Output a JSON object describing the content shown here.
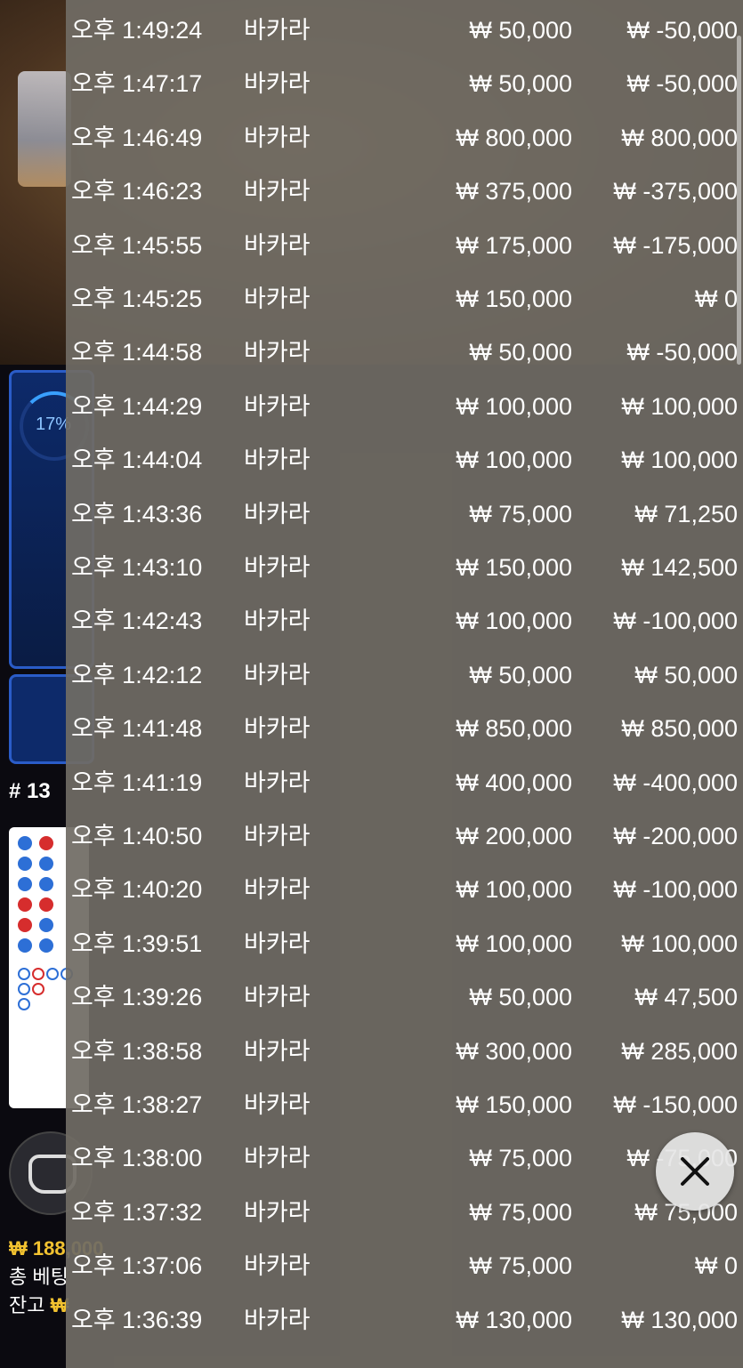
{
  "background": {
    "progress_label": "17%",
    "round_label": "# 13",
    "bet_total": "₩ 188,000",
    "total_bet_label": "총 베팅",
    "balance_label": "잔고",
    "balance_symbol": "₩"
  },
  "history": {
    "rows": [
      {
        "time": "오후 1:49:24",
        "game": "바카라",
        "bet": "₩ 50,000",
        "win": "₩ -50,000"
      },
      {
        "time": "오후 1:47:17",
        "game": "바카라",
        "bet": "₩ 50,000",
        "win": "₩ -50,000"
      },
      {
        "time": "오후 1:46:49",
        "game": "바카라",
        "bet": "₩ 800,000",
        "win": "₩ 800,000"
      },
      {
        "time": "오후 1:46:23",
        "game": "바카라",
        "bet": "₩ 375,000",
        "win": "₩ -375,000"
      },
      {
        "time": "오후 1:45:55",
        "game": "바카라",
        "bet": "₩ 175,000",
        "win": "₩ -175,000"
      },
      {
        "time": "오후 1:45:25",
        "game": "바카라",
        "bet": "₩ 150,000",
        "win": "₩ 0"
      },
      {
        "time": "오후 1:44:58",
        "game": "바카라",
        "bet": "₩ 50,000",
        "win": "₩ -50,000"
      },
      {
        "time": "오후 1:44:29",
        "game": "바카라",
        "bet": "₩ 100,000",
        "win": "₩ 100,000"
      },
      {
        "time": "오후 1:44:04",
        "game": "바카라",
        "bet": "₩ 100,000",
        "win": "₩ 100,000"
      },
      {
        "time": "오후 1:43:36",
        "game": "바카라",
        "bet": "₩ 75,000",
        "win": "₩ 71,250"
      },
      {
        "time": "오후 1:43:10",
        "game": "바카라",
        "bet": "₩ 150,000",
        "win": "₩ 142,500"
      },
      {
        "time": "오후 1:42:43",
        "game": "바카라",
        "bet": "₩ 100,000",
        "win": "₩ -100,000"
      },
      {
        "time": "오후 1:42:12",
        "game": "바카라",
        "bet": "₩ 50,000",
        "win": "₩ 50,000"
      },
      {
        "time": "오후 1:41:48",
        "game": "바카라",
        "bet": "₩ 850,000",
        "win": "₩ 850,000"
      },
      {
        "time": "오후 1:41:19",
        "game": "바카라",
        "bet": "₩ 400,000",
        "win": "₩ -400,000"
      },
      {
        "time": "오후 1:40:50",
        "game": "바카라",
        "bet": "₩ 200,000",
        "win": "₩ -200,000"
      },
      {
        "time": "오후 1:40:20",
        "game": "바카라",
        "bet": "₩ 100,000",
        "win": "₩ -100,000"
      },
      {
        "time": "오후 1:39:51",
        "game": "바카라",
        "bet": "₩ 100,000",
        "win": "₩ 100,000"
      },
      {
        "time": "오후 1:39:26",
        "game": "바카라",
        "bet": "₩ 50,000",
        "win": "₩ 47,500"
      },
      {
        "time": "오후 1:38:58",
        "game": "바카라",
        "bet": "₩ 300,000",
        "win": "₩ 285,000"
      },
      {
        "time": "오후 1:38:27",
        "game": "바카라",
        "bet": "₩ 150,000",
        "win": "₩ -150,000"
      },
      {
        "time": "오후 1:38:00",
        "game": "바카라",
        "bet": "₩ 75,000",
        "win": "₩ -75,000"
      },
      {
        "time": "오후 1:37:32",
        "game": "바카라",
        "bet": "₩ 75,000",
        "win": "₩ 75,000"
      },
      {
        "time": "오후 1:37:06",
        "game": "바카라",
        "bet": "₩ 75,000",
        "win": "₩ 0"
      },
      {
        "time": "오후 1:36:39",
        "game": "바카라",
        "bet": "₩ 130,000",
        "win": "₩ 130,000"
      }
    ]
  },
  "close_button": {
    "icon": "close-icon"
  }
}
